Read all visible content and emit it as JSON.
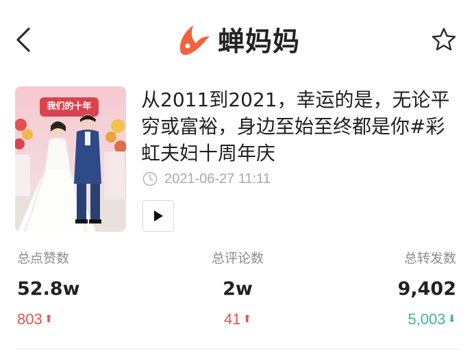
{
  "header": {
    "app_name": "蝉妈妈",
    "back_icon": "chevron-left-icon",
    "favorite_icon": "star-outline-icon",
    "brand_color": "#f1633f"
  },
  "video": {
    "thumbnail_caption": "我们的十年",
    "title": "从2011到2021，幸运的是，无论平穷或富裕，身边至始至终都是你#彩虹夫妇十周年庆",
    "publish_time": "2021-06-27 11:11",
    "play_icon": "play-icon"
  },
  "stats": [
    {
      "label": "总点赞数",
      "value": "52.8w",
      "change": "803",
      "direction": "up"
    },
    {
      "label": "总评论数",
      "value": "2w",
      "change": "41",
      "direction": "up"
    },
    {
      "label": "总转发数",
      "value": "9,402",
      "change": "5,003",
      "direction": "down"
    }
  ],
  "colors": {
    "increase": "#e8524f",
    "decrease": "#3db89a",
    "muted_text": "#a8a8a8"
  }
}
